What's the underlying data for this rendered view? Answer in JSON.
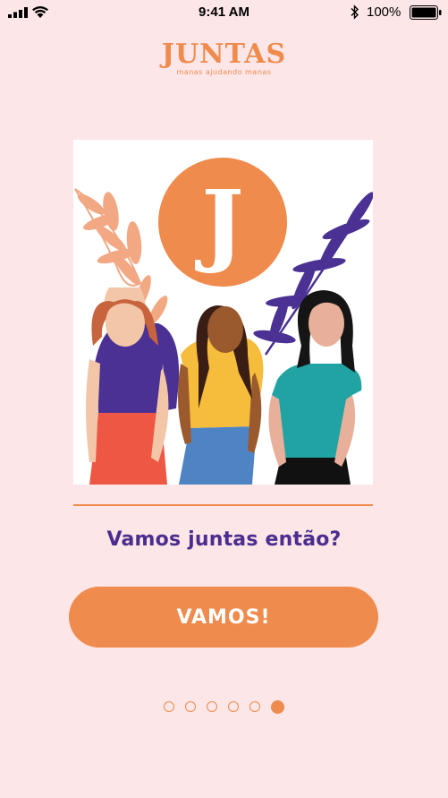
{
  "status_bar": {
    "time": "9:41 AM",
    "battery_percent": "100%",
    "signal_icon": "cellular-signal-icon",
    "wifi_icon": "wifi-icon",
    "bluetooth_icon": "bluetooth-icon",
    "battery_icon": "battery-icon"
  },
  "logo": {
    "wordmark": "JUNTAS",
    "tagline": "manas ajudando manas"
  },
  "illustration": {
    "badge_letter": "J",
    "description_icon": "three-women-illustration"
  },
  "onboarding": {
    "question": "Vamos juntas então?",
    "button_label": "VAMOS!",
    "page_count": 6,
    "current_page": 6
  },
  "colors": {
    "background": "#fce6e7",
    "accent": "#ef8b4c",
    "text_purple": "#4a2d8f"
  }
}
